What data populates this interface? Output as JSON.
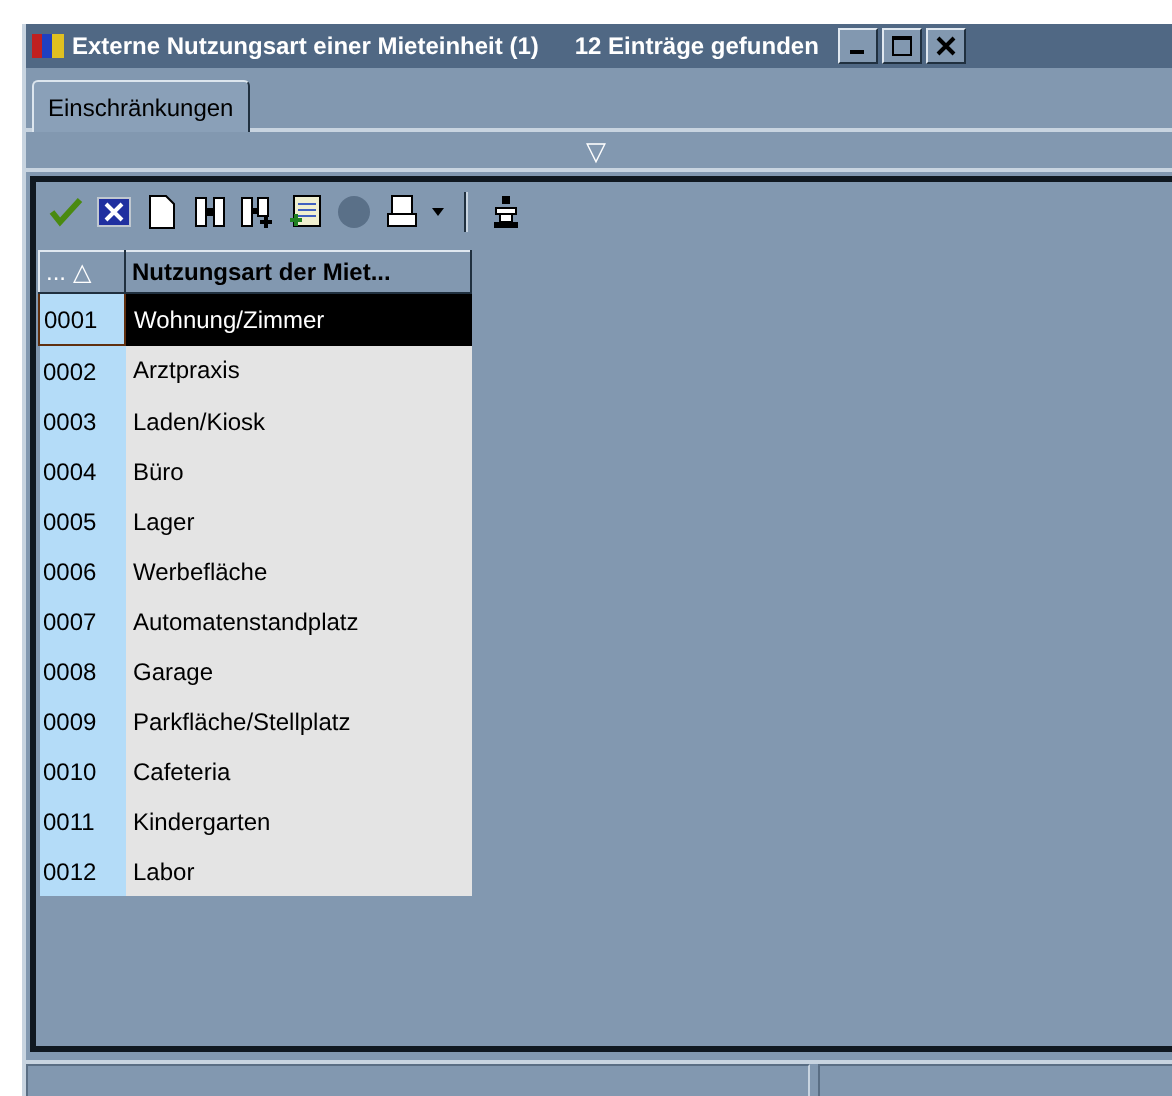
{
  "window": {
    "title": "Externe Nutzungsart einer Mieteinheit (1)",
    "status": "12 Einträge gefunden"
  },
  "tabs": [
    {
      "label": "Einschränkungen",
      "selected": true
    }
  ],
  "splitter": {
    "glyph": "▽"
  },
  "toolbar": [
    {
      "kind": "check",
      "disabled": false
    },
    {
      "kind": "cancel",
      "disabled": false
    },
    {
      "kind": "new",
      "disabled": false
    },
    {
      "kind": "find",
      "disabled": false
    },
    {
      "kind": "findadd",
      "disabled": false
    },
    {
      "kind": "import",
      "disabled": false
    },
    {
      "kind": "circle",
      "disabled": true
    },
    {
      "kind": "print",
      "disabled": false
    },
    {
      "kind": "caret",
      "disabled": false
    },
    {
      "kind": "separator"
    },
    {
      "kind": "stamp",
      "disabled": false
    }
  ],
  "table": {
    "columns": [
      {
        "label": "... △"
      },
      {
        "label": "Nutzungsart der Miet..."
      }
    ],
    "rows": [
      {
        "code": "0001",
        "name": "Wohnung/Zimmer",
        "selected": true
      },
      {
        "code": "0002",
        "name": "Arztpraxis",
        "selected": false
      },
      {
        "code": "0003",
        "name": "Laden/Kiosk",
        "selected": false
      },
      {
        "code": "0004",
        "name": "Büro",
        "selected": false
      },
      {
        "code": "0005",
        "name": "Lager",
        "selected": false
      },
      {
        "code": "0006",
        "name": "Werbefläche",
        "selected": false
      },
      {
        "code": "0007",
        "name": "Automatenstandplatz",
        "selected": false
      },
      {
        "code": "0008",
        "name": "Garage",
        "selected": false
      },
      {
        "code": "0009",
        "name": "Parkfläche/Stellplatz",
        "selected": false
      },
      {
        "code": "0010",
        "name": "Cafeteria",
        "selected": false
      },
      {
        "code": "0011",
        "name": "Kindergarten",
        "selected": false
      },
      {
        "code": "0012",
        "name": "Labor",
        "selected": false
      }
    ]
  }
}
